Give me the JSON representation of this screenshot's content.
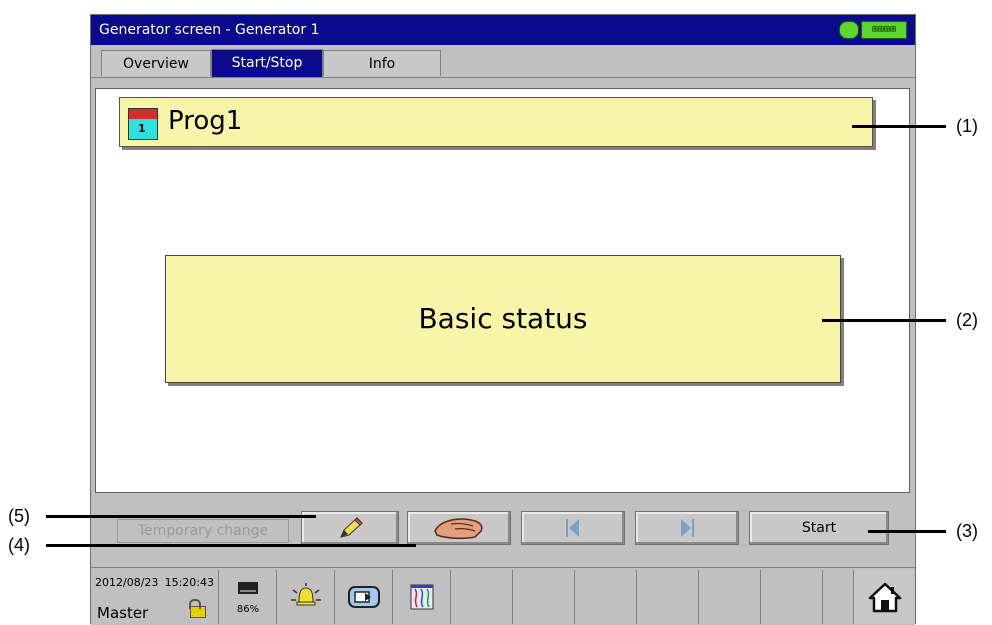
{
  "window": {
    "title": "Generator screen - Generator 1",
    "status_indicator": "⊞⊞⊞⊞"
  },
  "tabs": [
    {
      "label": "Overview",
      "active": false
    },
    {
      "label": "Start/Stop",
      "active": true
    },
    {
      "label": "Info",
      "active": false
    }
  ],
  "program": {
    "number": "1",
    "name": "Prog1"
  },
  "status": {
    "text": "Basic status"
  },
  "buttons": {
    "temporary_change": "Temporary change",
    "edit_icon": "pencil-icon",
    "manual_icon": "hand-icon",
    "prev_icon": "step-back-icon",
    "next_icon": "step-forward-icon",
    "start": "Start"
  },
  "footer": {
    "date": "2012/08/23",
    "time": "15:20:43",
    "user": "Master",
    "memory": "86%",
    "icons": [
      "memory-icon",
      "alarm-bell-icon",
      "screen-switch-icon",
      "trend-chart-icon",
      "home-icon"
    ]
  },
  "annotations": [
    "(1)",
    "(2)",
    "(3)",
    "(4)",
    "(5)"
  ],
  "colors": {
    "titlebar": "#0a0a8c",
    "panel_yellow": "#f8f4a8",
    "frame": "#c0c0c0"
  }
}
